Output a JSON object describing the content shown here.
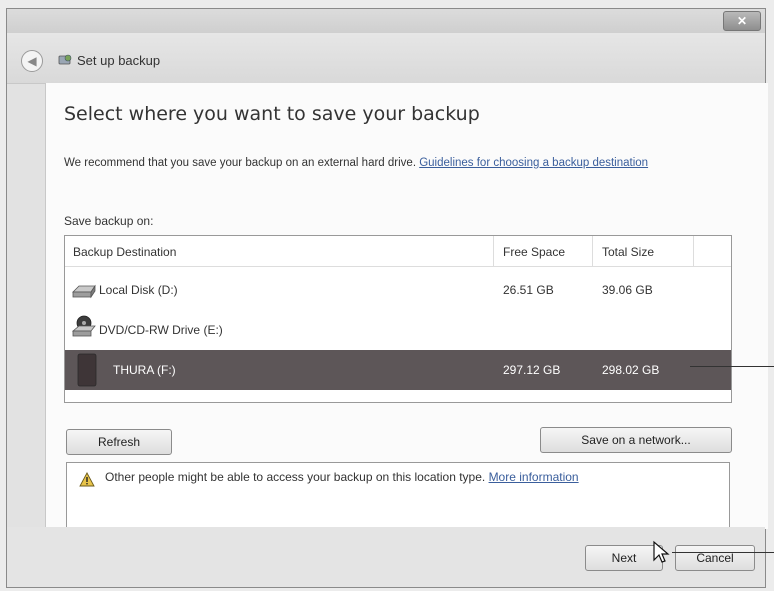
{
  "window": {
    "close_label": "✕"
  },
  "nav": {
    "title": "Set up backup"
  },
  "page": {
    "heading": "Select where you want to save your backup",
    "recommend_text": "We recommend that you save your backup on an external hard drive. ",
    "recommend_link": "Guidelines for choosing a backup destination",
    "save_on_label": "Save backup on:"
  },
  "table": {
    "columns": [
      "Backup Destination",
      "Free Space",
      "Total Size"
    ],
    "rows": [
      {
        "name": "Local Disk (D:)",
        "free": "26.51 GB",
        "total": "39.06 GB",
        "icon": "hard-disk-icon"
      },
      {
        "name": "DVD/CD-RW Drive (E:)",
        "free": "",
        "total": "",
        "icon": "dvd-drive-icon"
      },
      {
        "name": "THURA (F:)",
        "free": "297.12 GB",
        "total": "298.02 GB",
        "icon": "external-drive-icon",
        "selected": true
      }
    ]
  },
  "buttons": {
    "refresh": "Refresh",
    "network": "Save on a network...",
    "next": "Next",
    "cancel": "Cancel"
  },
  "warning": {
    "text": "Other people might be able to access your backup on this location type. ",
    "link": "More information"
  }
}
